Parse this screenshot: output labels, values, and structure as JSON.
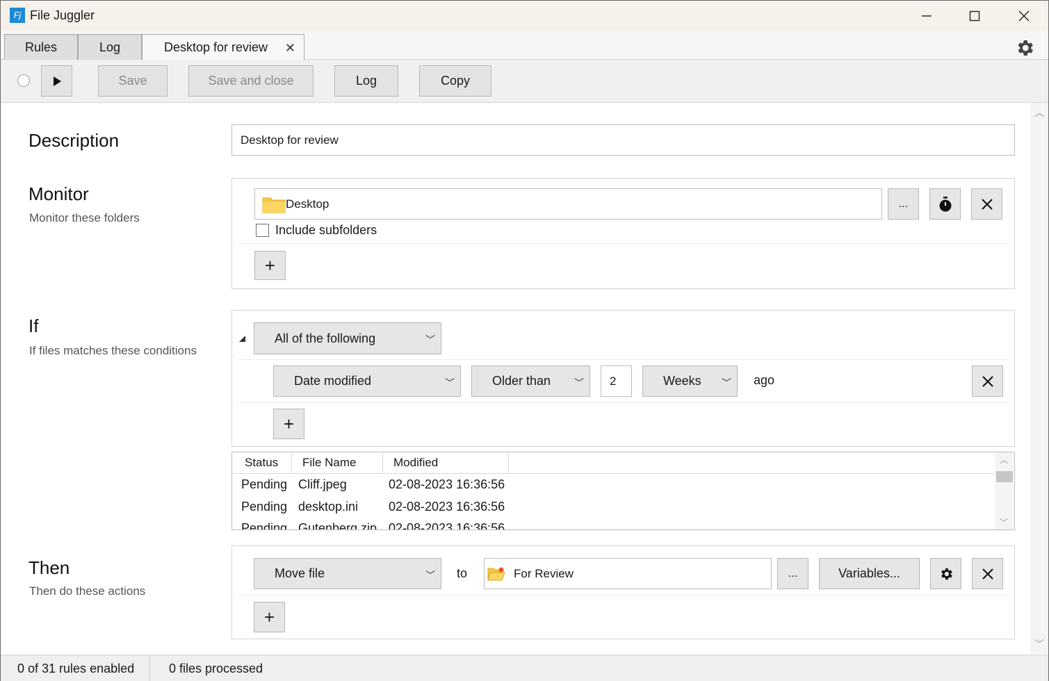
{
  "window": {
    "title": "File Juggler",
    "icon_label": "Fj",
    "controls": [
      "minimize-icon",
      "maximize-icon",
      "close-icon"
    ]
  },
  "tabs": [
    {
      "label": "Rules"
    },
    {
      "label": "Log"
    },
    {
      "label": "Desktop for review",
      "active": true,
      "closable": true
    }
  ],
  "toolbar": {
    "run_icon": "play-icon",
    "save_label": "Save",
    "save_close_label": "Save and close",
    "log_label": "Log",
    "copy_label": "Copy"
  },
  "description": {
    "title": "Description",
    "value": "Desktop for review"
  },
  "monitor": {
    "title": "Monitor",
    "subtitle": "Monitor these folders",
    "folder": "Desktop",
    "browse_label": "...",
    "include_subfolders_label": "Include subfolders",
    "include_subfolders_checked": false,
    "add_label": "+"
  },
  "if": {
    "title": "If",
    "subtitle": "If files matches these conditions",
    "group_mode": "All of the following",
    "condition": {
      "field": "Date modified",
      "operator": "Older than",
      "amount": "2",
      "unit": "Weeks",
      "suffix": "ago"
    },
    "add_label": "+"
  },
  "preview": {
    "columns": [
      "Status",
      "File Name",
      "Modified"
    ],
    "rows": [
      {
        "status": "Pending",
        "name": "Cliff.jpeg",
        "modified": "02-08-2023 16:36:56"
      },
      {
        "status": "Pending",
        "name": "desktop.ini",
        "modified": "02-08-2023 16:36:56"
      },
      {
        "status": "Pending",
        "name": "Gutenberg.zip",
        "modified": "02-08-2023 16:36:56"
      }
    ]
  },
  "then": {
    "title": "Then",
    "subtitle": "Then do these actions",
    "action": "Move file",
    "to_label": "to",
    "destination": "For Review",
    "browse_label": "...",
    "variables_label": "Variables...",
    "add_label": "+"
  },
  "status": {
    "rules": "0 of 31 rules enabled",
    "files": "0 files processed"
  },
  "colors": {
    "titlebar": "#f6f1ea",
    "app_icon": "#1d8ad6",
    "folder": "#f5c842"
  }
}
